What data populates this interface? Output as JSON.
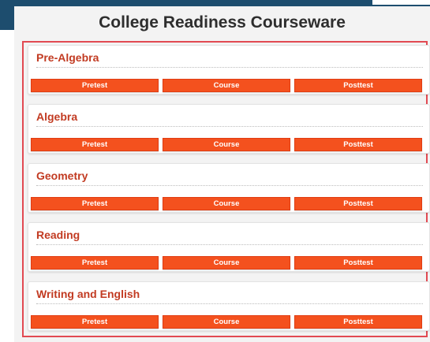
{
  "page": {
    "title": "College Readiness Courseware"
  },
  "courses": [
    {
      "title": "Pre-Algebra",
      "buttons": [
        "Pretest",
        "Course",
        "Posttest"
      ]
    },
    {
      "title": "Algebra",
      "buttons": [
        "Pretest",
        "Course",
        "Posttest"
      ]
    },
    {
      "title": "Geometry",
      "buttons": [
        "Pretest",
        "Course",
        "Posttest"
      ]
    },
    {
      "title": "Reading",
      "buttons": [
        "Pretest",
        "Course",
        "Posttest"
      ]
    },
    {
      "title": "Writing and English",
      "buttons": [
        "Pretest",
        "Course",
        "Posttest"
      ]
    }
  ],
  "colors": {
    "header_bar": "#1d4d6e",
    "course_title": "#c23b22",
    "button": "#f4511e",
    "highlight_border": "#e24a52"
  }
}
